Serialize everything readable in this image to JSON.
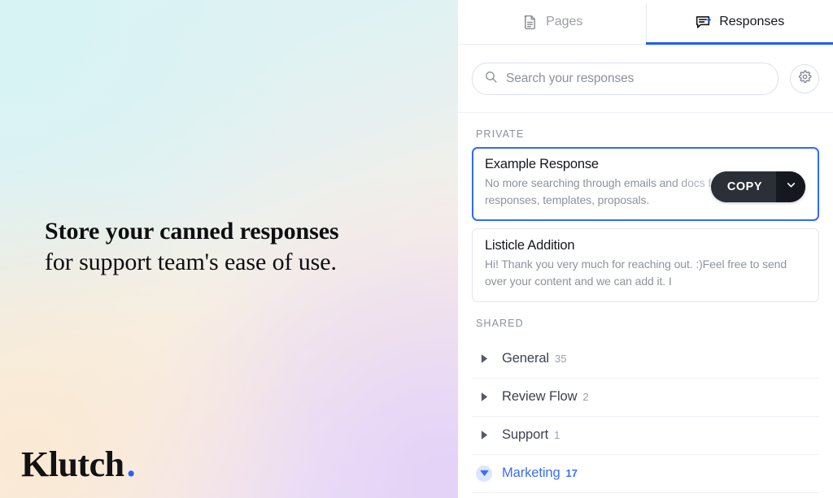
{
  "promo": {
    "headline_line1": "Store your canned responses",
    "headline_line2": "for support team's ease of use.",
    "logo_text": "Klutch",
    "logo_dot": ".",
    "brand_accent": "#2563f0"
  },
  "app": {
    "tabs": [
      {
        "label": "Pages",
        "icon": "document-icon",
        "active": false
      },
      {
        "label": "Responses",
        "icon": "chat-bubble-icon",
        "active": true
      }
    ],
    "accent_color": "#1a5cff",
    "search": {
      "placeholder": "Search your responses",
      "value": "",
      "icon": "search-icon"
    },
    "settings_button": {
      "icon": "gear-icon"
    },
    "sections": {
      "private": {
        "label": "PRIVATE",
        "cards": [
          {
            "title": "Example Response",
            "body": "No more searching through emails and docs for pre-made responses, templates, proposals.",
            "selected": true,
            "copy_label": "COPY",
            "copy_caret_icon": "chevron-down-icon"
          },
          {
            "title": "Listicle Addition",
            "body": "Hi! Thank you very much for reaching out. :)Feel free to send over your content and we can add it. I",
            "selected": false
          }
        ]
      },
      "shared": {
        "label": "SHARED",
        "folders": [
          {
            "name": "General",
            "count": "35",
            "expanded": false,
            "icon": "chevron-right-icon"
          },
          {
            "name": "Review Flow",
            "count": "2",
            "expanded": false,
            "icon": "chevron-right-icon"
          },
          {
            "name": "Support",
            "count": "1",
            "expanded": false,
            "icon": "chevron-right-icon"
          },
          {
            "name": "Marketing",
            "count": "17",
            "expanded": true,
            "icon": "chevron-down-icon"
          }
        ]
      }
    }
  }
}
